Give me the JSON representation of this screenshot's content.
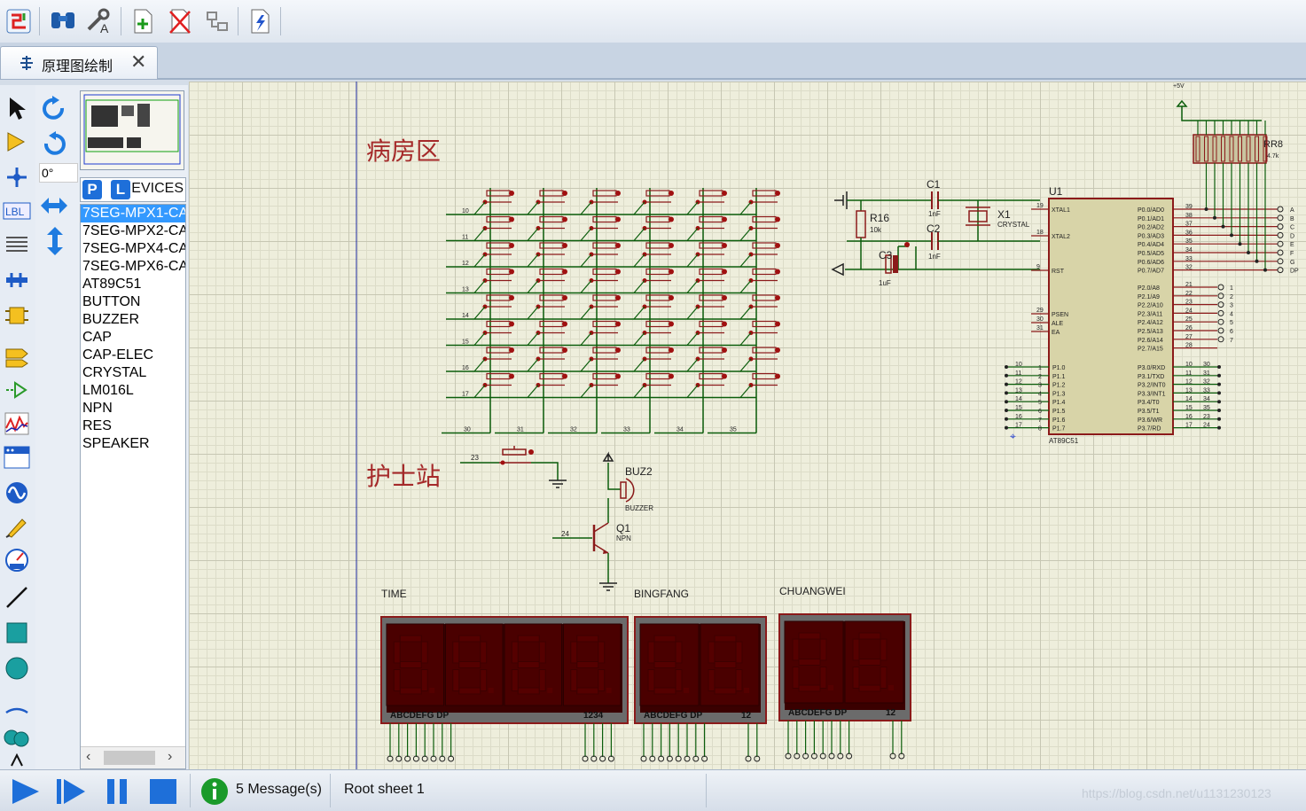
{
  "tab": {
    "label": "原理图绘制",
    "close": "✕"
  },
  "panel": {
    "angle": "0°",
    "device_header": "DEVICES",
    "pick_button": "P",
    "lib_button": "L",
    "devices": [
      "7SEG-MPX1-CA",
      "7SEG-MPX2-CA",
      "7SEG-MPX4-CA",
      "7SEG-MPX6-CA",
      "AT89C51",
      "BUTTON",
      "BUZZER",
      "CAP",
      "CAP-ELEC",
      "CRYSTAL",
      "LM016L",
      "NPN",
      "RES",
      "SPEAKER"
    ],
    "selected_device": "7SEG-MPX1-CA"
  },
  "schematic": {
    "ward_label": "病房区",
    "nurse_label": "护士站",
    "time_label": "TIME",
    "bingfang_label": "BINGFANG",
    "chuangwei_label": "CHUANGWEI",
    "time_display_pins": "ABCDEFG DP",
    "time_display_digits": "1234",
    "bingfang_display_pins": "ABCDEFG DP",
    "bingfang_display_digits": "12",
    "chuangwei_display_pins": "ABCDEFG DP",
    "chuangwei_display_digits": "12",
    "row_pins": [
      "10",
      "11",
      "12",
      "13",
      "14",
      "15",
      "16",
      "17"
    ],
    "col_pins": [
      "30",
      "31",
      "32",
      "33",
      "34",
      "35"
    ],
    "nurse_button_pin": "23",
    "transistor_pin": "24",
    "mcu_ref": "U1",
    "mcu_part": "AT89C51",
    "mcu_left_pins": [
      {
        "num": "19",
        "name": "XTAL1"
      },
      {
        "num": "18",
        "name": "XTAL2"
      },
      {
        "num": "9",
        "name": "RST"
      },
      {
        "num": "29",
        "name": "PSEN"
      },
      {
        "num": "30",
        "name": "ALE"
      },
      {
        "num": "31",
        "name": "EA"
      }
    ],
    "mcu_p1_pins": [
      {
        "num": "1",
        "name": "P1.0"
      },
      {
        "num": "2",
        "name": "P1.1"
      },
      {
        "num": "3",
        "name": "P1.2"
      },
      {
        "num": "4",
        "name": "P1.3"
      },
      {
        "num": "5",
        "name": "P1.4"
      },
      {
        "num": "6",
        "name": "P1.5"
      },
      {
        "num": "7",
        "name": "P1.6"
      },
      {
        "num": "8",
        "name": "P1.7"
      }
    ],
    "mcu_p1_nets": [
      "10",
      "11",
      "12",
      "13",
      "14",
      "15",
      "16",
      "17"
    ],
    "mcu_p0_pins": [
      {
        "num": "39",
        "name": "P0.0/AD0",
        "net": "A"
      },
      {
        "num": "38",
        "name": "P0.1/AD1",
        "net": "B"
      },
      {
        "num": "37",
        "name": "P0.2/AD2",
        "net": "C"
      },
      {
        "num": "36",
        "name": "P0.3/AD3",
        "net": "D"
      },
      {
        "num": "35",
        "name": "P0.4/AD4",
        "net": "E"
      },
      {
        "num": "34",
        "name": "P0.5/AD5",
        "net": "F"
      },
      {
        "num": "33",
        "name": "P0.6/AD6",
        "net": "G"
      },
      {
        "num": "32",
        "name": "P0.7/AD7",
        "net": "DP"
      }
    ],
    "mcu_p2_pins": [
      {
        "num": "21",
        "name": "P2.0/A8",
        "net": "1"
      },
      {
        "num": "22",
        "name": "P2.1/A9",
        "net": "2"
      },
      {
        "num": "23",
        "name": "P2.2/A10",
        "net": "3"
      },
      {
        "num": "24",
        "name": "P2.3/A11",
        "net": "4"
      },
      {
        "num": "25",
        "name": "P2.4/A12",
        "net": "5"
      },
      {
        "num": "26",
        "name": "P2.5/A13",
        "net": "6"
      },
      {
        "num": "27",
        "name": "P2.6/A14",
        "net": "7"
      },
      {
        "num": "28",
        "name": "P2.7/A15",
        "net": ""
      }
    ],
    "mcu_p3_pins": [
      {
        "num": "10",
        "name": "P3.0/RXD",
        "net": "30"
      },
      {
        "num": "11",
        "name": "P3.1/TXD",
        "net": "31"
      },
      {
        "num": "12",
        "name": "P3.2/INT0",
        "net": "32"
      },
      {
        "num": "13",
        "name": "P3.3/INT1",
        "net": "33"
      },
      {
        "num": "14",
        "name": "P3.4/T0",
        "net": "34"
      },
      {
        "num": "15",
        "name": "P3.5/T1",
        "net": "35"
      },
      {
        "num": "16",
        "name": "P3.6/WR",
        "net": "23"
      },
      {
        "num": "17",
        "name": "P3.7/RD",
        "net": "24"
      }
    ],
    "c1_ref": "C1",
    "c1_val": "1nF",
    "c2_ref": "C2",
    "c2_val": "1nF",
    "c3_ref": "C3",
    "c3_val": "1uF",
    "r16_ref": "R16",
    "r16_val": "10k",
    "x1_ref": "X1",
    "x1_val": "CRYSTAL",
    "rr8_ref": "RR8",
    "rr8_val": "4.7k",
    "vcc_label": "+5V",
    "buz_ref": "BUZ2",
    "buz_val": "BUZZER",
    "q1_ref": "Q1",
    "q1_val": "NPN"
  },
  "status": {
    "messages": "5 Message(s)",
    "sheet": "Root sheet 1",
    "watermark": "https://blog.csdn.net/u1131230123"
  },
  "colors": {
    "wire": "#0b5d0b",
    "part": "#8b1a1a",
    "text_red": "#a52a2a",
    "seg_bg": "#3a0000",
    "seg_on": "#550000",
    "selection": "#3399ff"
  }
}
